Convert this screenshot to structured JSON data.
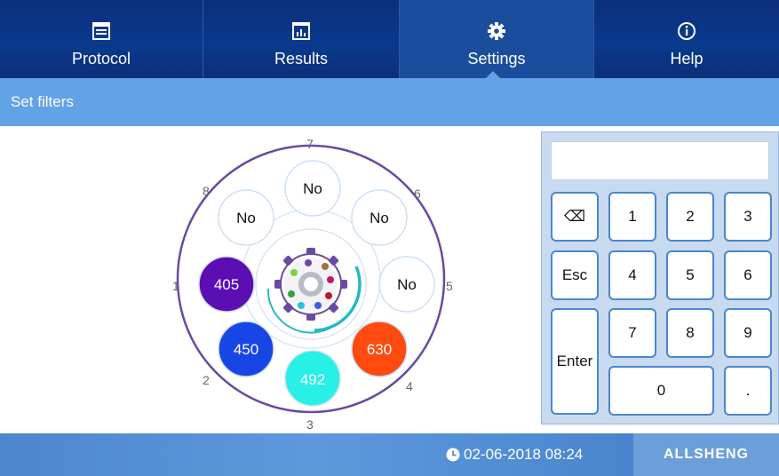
{
  "nav": {
    "tabs": [
      {
        "label": "Protocol",
        "icon": "protocol-window-icon"
      },
      {
        "label": "Results",
        "icon": "results-chart-icon"
      },
      {
        "label": "Settings",
        "icon": "gear-icon"
      },
      {
        "label": "Help",
        "icon": "info-icon"
      }
    ],
    "active": "Settings"
  },
  "header": {
    "title": "Set filters"
  },
  "wheel": {
    "slots": [
      {
        "position": "1",
        "label": "405",
        "color": "#5b0fb3"
      },
      {
        "position": "2",
        "label": "450",
        "color": "#1846e6"
      },
      {
        "position": "3",
        "label": "492",
        "color": "#29f0e6"
      },
      {
        "position": "4",
        "label": "630",
        "color": "#ff4a10"
      },
      {
        "position": "5",
        "label": "No",
        "color": "#ffffff"
      },
      {
        "position": "6",
        "label": "No",
        "color": "#ffffff"
      },
      {
        "position": "7",
        "label": "No",
        "color": "#ffffff"
      },
      {
        "position": "8",
        "label": "No",
        "color": "#ffffff"
      }
    ],
    "ring_color": "#6a4aa0"
  },
  "keypad": {
    "display_value": "",
    "keys": {
      "backspace": "⌫",
      "k1": "1",
      "k2": "2",
      "k3": "3",
      "esc": "Esc",
      "k4": "4",
      "k5": "5",
      "k6": "6",
      "enter": "Enter",
      "k7": "7",
      "k8": "8",
      "k9": "9",
      "k0": "0",
      "dot": "."
    }
  },
  "footer": {
    "datetime": "02-06-2018 08:24",
    "brand": "ALLSHENG"
  }
}
